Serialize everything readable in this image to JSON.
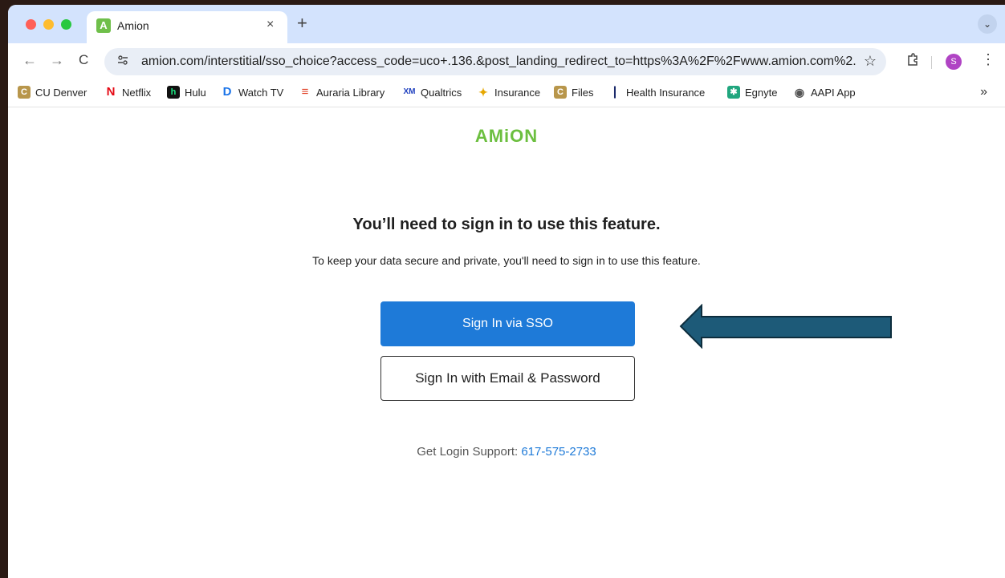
{
  "tab": {
    "favicon": "A",
    "title": "Amion",
    "close": "×",
    "new_tab": "+"
  },
  "toolbar": {
    "back": "←",
    "forward": "→",
    "reload": "C",
    "site_info_icon": "tune-icon",
    "url_domain": "amion.com",
    "url_rest": "/interstitial/sso_choice?access_code=uco+.136.&post_landing_redirect_to=https%3A%2F%2Fwww.amion.com%2...",
    "star": "☆",
    "profile_initial": "S",
    "menu": "⋮",
    "tab_menu": "⌄"
  },
  "bookmarks": [
    {
      "label": "CU Denver",
      "icon": "cu-denver-icon",
      "color": "#b8964b",
      "glyph": "C"
    },
    {
      "label": "Netflix",
      "icon": "netflix-icon",
      "color": "#e50914",
      "glyph": "N"
    },
    {
      "label": "Hulu",
      "icon": "hulu-icon",
      "color": "#111111",
      "glyph": "h"
    },
    {
      "label": "Watch TV",
      "icon": "directv-icon",
      "color": "#1a73e8",
      "glyph": "D"
    },
    {
      "label": "Auraria Library",
      "icon": "library-icon",
      "color": "#e2462c",
      "glyph": "≡"
    },
    {
      "label": "Qualtrics",
      "icon": "qualtrics-icon",
      "color": "#1e3fbf",
      "glyph": "XM"
    },
    {
      "label": "Insurance",
      "icon": "insurance-icon",
      "color": "#3aa7d8",
      "glyph": "✦"
    },
    {
      "label": "Files",
      "icon": "files-icon",
      "color": "#b8964b",
      "glyph": "C"
    },
    {
      "label": "Health Insurance",
      "icon": "health-insurance-icon",
      "color": "#1b2a6b",
      "glyph": "|"
    },
    {
      "label": "Egnyte",
      "icon": "egnyte-icon",
      "color": "#20a67e",
      "glyph": "✱"
    },
    {
      "label": "AAPI App",
      "icon": "globe-icon",
      "color": "#555555",
      "glyph": "◉"
    }
  ],
  "bookmarks_more": "»",
  "page": {
    "logo": "AMiON",
    "heading": "You’ll need to sign in to use this feature.",
    "subtext": "To keep your data secure and private, you'll need to sign in to use this feature.",
    "sso_button": "Sign In via SSO",
    "email_button": "Sign In with Email & Password",
    "support_label": "Get Login Support: ",
    "support_phone": "617-575-2733"
  },
  "colors": {
    "brand_green": "#6cbf3f",
    "primary_blue": "#1e7ad8",
    "arrow_fill": "#1d5a78"
  }
}
